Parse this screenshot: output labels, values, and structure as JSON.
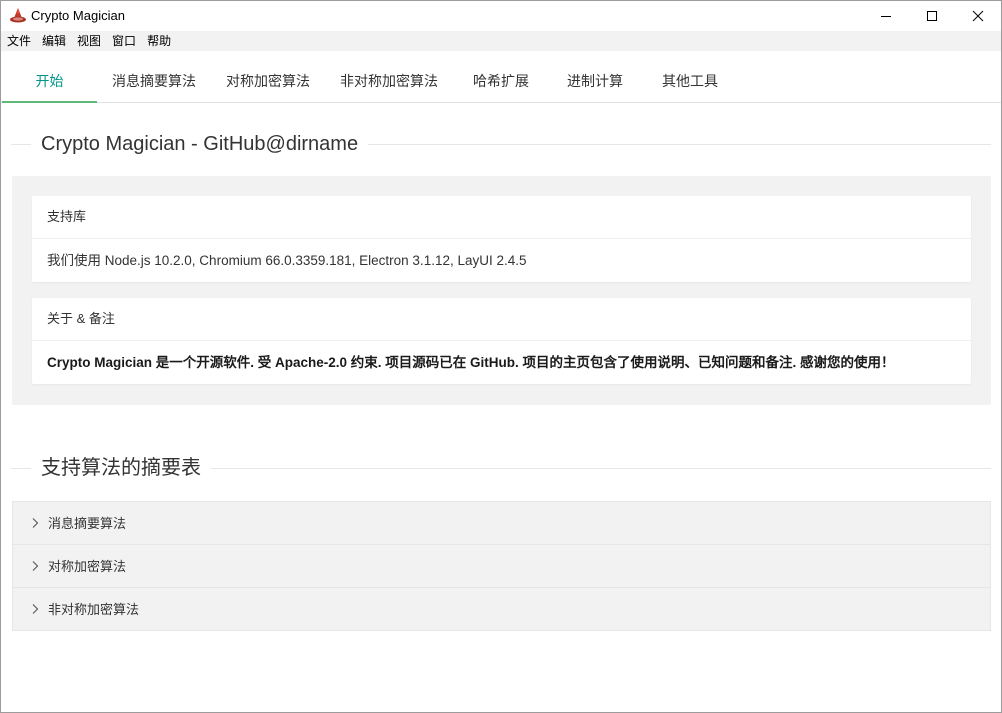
{
  "window": {
    "title": "Crypto Magician"
  },
  "menu": [
    "文件",
    "编辑",
    "视图",
    "窗口",
    "帮助"
  ],
  "tabs": [
    {
      "label": "开始",
      "active": true
    },
    {
      "label": "消息摘要算法",
      "active": false
    },
    {
      "label": "对称加密算法",
      "active": false
    },
    {
      "label": "非对称加密算法",
      "active": false
    },
    {
      "label": "哈希扩展",
      "active": false
    },
    {
      "label": "进制计算",
      "active": false
    },
    {
      "label": "其他工具",
      "active": false
    }
  ],
  "intro": {
    "heading": "Crypto Magician - GitHub@dirname",
    "support_card": {
      "header": "支持库",
      "body": "我们使用 Node.js 10.2.0, Chromium 66.0.3359.181, Electron 3.1.12, LayUI 2.4.5"
    },
    "about_card": {
      "header": "关于 & 备注",
      "body": "Crypto Magician 是一个开源软件. 受 Apache-2.0 约束. 项目源码已在 GitHub. 项目的主页包含了使用说明、已知问题和备注. 感谢您的使用！"
    }
  },
  "summary": {
    "heading": "支持算法的摘要表",
    "items": [
      "消息摘要算法",
      "对称加密算法",
      "非对称加密算法"
    ]
  },
  "colors": {
    "accent": "#009688",
    "tab_underline": "#5fb878",
    "panel_bg": "#f2f2f2"
  }
}
